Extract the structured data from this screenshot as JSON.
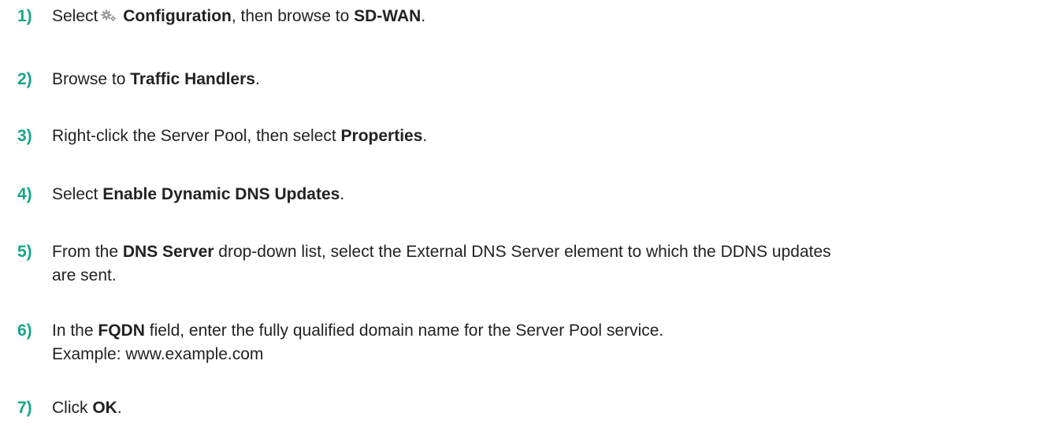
{
  "steps": [
    {
      "number": "1)",
      "parts": {
        "t1": "Select",
        "icon": "gear-icon",
        "b1": "Configuration",
        "t2": ", then browse to",
        "b2": "SD-WAN",
        "t3": "."
      }
    },
    {
      "number": "2)",
      "parts": {
        "t1": "Browse to",
        "b1": "Traffic Handlers",
        "t2": "."
      }
    },
    {
      "number": "3)",
      "parts": {
        "t1": "Right-click the Server Pool, then select",
        "b1": "Properties",
        "t2": "."
      }
    },
    {
      "number": "4)",
      "parts": {
        "t1": "Select",
        "b1": "Enable Dynamic DNS Updates",
        "t2": "."
      }
    },
    {
      "number": "5)",
      "parts": {
        "t1": "From the",
        "b1": "DNS Server",
        "t2": "drop-down list, select the External DNS Server element to which the DDNS updates",
        "t3": "are sent."
      }
    },
    {
      "number": "6)",
      "parts": {
        "t1": "In the",
        "b1": "FQDN",
        "t2": "field, enter the fully qualified domain name for the Server Pool service.",
        "t3": "Example: www.example.com"
      }
    },
    {
      "number": "7)",
      "parts": {
        "t1": "Click",
        "b1": "OK",
        "t2": "."
      }
    }
  ],
  "colors": {
    "step_number": "#17a589",
    "text": "#222222",
    "icon": "#999999"
  }
}
